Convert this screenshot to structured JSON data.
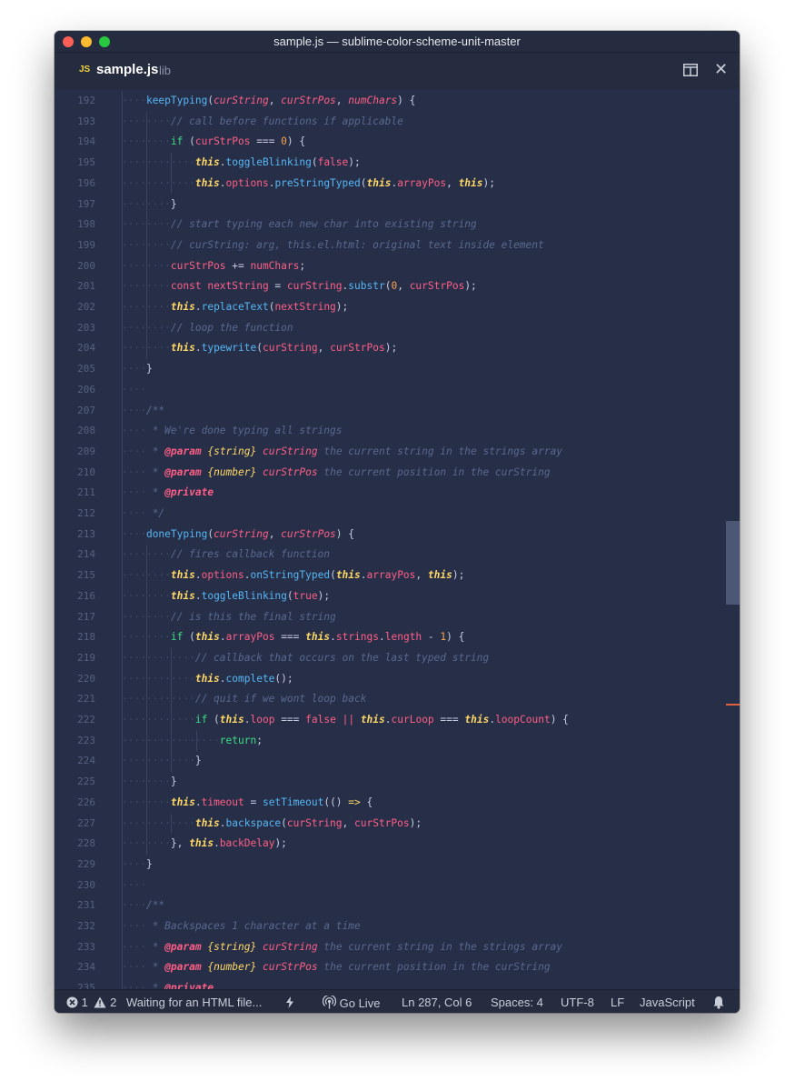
{
  "window": {
    "title": "sample.js — sublime-color-scheme-unit-master"
  },
  "tab": {
    "icon_text": "JS",
    "file": "sample.js",
    "dir": "lib"
  },
  "icons": {
    "split": "split-pane-icon",
    "close": "close-icon",
    "errors": "error-circle-icon",
    "warnings": "warning-triangle-icon",
    "plugin": "lightning-icon",
    "golive": "broadcast-icon",
    "notify": "bell-icon"
  },
  "editor": {
    "lines": [
      {
        "n": "192",
        "d": 1,
        "t": [
          [
            "f",
            "keepTyping"
          ],
          [
            "pl",
            "("
          ],
          [
            "p",
            "curString"
          ],
          [
            "pl",
            ", "
          ],
          [
            "p",
            "curStrPos"
          ],
          [
            "pl",
            ", "
          ],
          [
            "p",
            "numChars"
          ],
          [
            "pl",
            ") {"
          ]
        ]
      },
      {
        "n": "193",
        "d": 2,
        "t": [
          [
            "c",
            "// call before functions if applicable"
          ]
        ]
      },
      {
        "n": "194",
        "d": 2,
        "t": [
          [
            "k",
            "if"
          ],
          [
            "pl",
            " ("
          ],
          [
            "v",
            "curStrPos"
          ],
          [
            "pl",
            " === "
          ],
          [
            "n",
            "0"
          ],
          [
            "pl",
            ") {"
          ]
        ]
      },
      {
        "n": "195",
        "d": 3,
        "t": [
          [
            "th",
            "this"
          ],
          [
            "pl",
            "."
          ],
          [
            "f",
            "toggleBlinking"
          ],
          [
            "pl",
            "("
          ],
          [
            "v",
            "false"
          ],
          [
            "pl",
            ");"
          ]
        ]
      },
      {
        "n": "196",
        "d": 3,
        "t": [
          [
            "th",
            "this"
          ],
          [
            "pl",
            "."
          ],
          [
            "v",
            "options"
          ],
          [
            "pl",
            "."
          ],
          [
            "f",
            "preStringTyped"
          ],
          [
            "pl",
            "("
          ],
          [
            "th",
            "this"
          ],
          [
            "pl",
            "."
          ],
          [
            "v",
            "arrayPos"
          ],
          [
            "pl",
            ", "
          ],
          [
            "th",
            "this"
          ],
          [
            "pl",
            ");"
          ]
        ]
      },
      {
        "n": "197",
        "d": 2,
        "t": [
          [
            "pl",
            "}"
          ]
        ]
      },
      {
        "n": "198",
        "d": 2,
        "t": [
          [
            "c",
            "// start typing each new char into existing string"
          ]
        ]
      },
      {
        "n": "199",
        "d": 2,
        "t": [
          [
            "c",
            "// curString: arg, this.el.html: original text inside element"
          ]
        ]
      },
      {
        "n": "200",
        "d": 2,
        "t": [
          [
            "v",
            "curStrPos"
          ],
          [
            "pl",
            " += "
          ],
          [
            "v",
            "numChars"
          ],
          [
            "pl",
            ";"
          ]
        ]
      },
      {
        "n": "201",
        "d": 2,
        "t": [
          [
            "v",
            "const"
          ],
          [
            "pl",
            " "
          ],
          [
            "v",
            "nextString"
          ],
          [
            "pl",
            " = "
          ],
          [
            "v",
            "curString"
          ],
          [
            "pl",
            "."
          ],
          [
            "f",
            "substr"
          ],
          [
            "pl",
            "("
          ],
          [
            "n",
            "0"
          ],
          [
            "pl",
            ", "
          ],
          [
            "v",
            "curStrPos"
          ],
          [
            "pl",
            ");"
          ]
        ]
      },
      {
        "n": "202",
        "d": 2,
        "t": [
          [
            "th",
            "this"
          ],
          [
            "pl",
            "."
          ],
          [
            "f",
            "replaceText"
          ],
          [
            "pl",
            "("
          ],
          [
            "v",
            "nextString"
          ],
          [
            "pl",
            ");"
          ]
        ]
      },
      {
        "n": "203",
        "d": 2,
        "t": [
          [
            "c",
            "// loop the function"
          ]
        ]
      },
      {
        "n": "204",
        "d": 2,
        "t": [
          [
            "th",
            "this"
          ],
          [
            "pl",
            "."
          ],
          [
            "f",
            "typewrite"
          ],
          [
            "pl",
            "("
          ],
          [
            "v",
            "curString"
          ],
          [
            "pl",
            ", "
          ],
          [
            "v",
            "curStrPos"
          ],
          [
            "pl",
            ");"
          ]
        ]
      },
      {
        "n": "205",
        "d": 1,
        "t": [
          [
            "pl",
            "}"
          ]
        ]
      },
      {
        "n": "206",
        "d": 1,
        "t": []
      },
      {
        "n": "207",
        "d": 1,
        "t": [
          [
            "c",
            "/**"
          ]
        ]
      },
      {
        "n": "208",
        "d": 1,
        "t": [
          [
            "c",
            " * We're done typing all strings"
          ]
        ]
      },
      {
        "n": "209",
        "d": 1,
        "t": [
          [
            "c",
            " * "
          ],
          [
            "tg",
            "@param"
          ],
          [
            "pl",
            " "
          ],
          [
            "ty",
            "{string}"
          ],
          [
            "pl",
            " "
          ],
          [
            "p",
            "curString"
          ],
          [
            "c",
            " the current string in the strings array"
          ]
        ]
      },
      {
        "n": "210",
        "d": 1,
        "t": [
          [
            "c",
            " * "
          ],
          [
            "tg",
            "@param"
          ],
          [
            "pl",
            " "
          ],
          [
            "ty",
            "{number}"
          ],
          [
            "pl",
            " "
          ],
          [
            "p",
            "curStrPos"
          ],
          [
            "c",
            " the current position in the curString"
          ]
        ]
      },
      {
        "n": "211",
        "d": 1,
        "t": [
          [
            "c",
            " * "
          ],
          [
            "tg",
            "@private"
          ]
        ]
      },
      {
        "n": "212",
        "d": 1,
        "t": [
          [
            "c",
            " */"
          ]
        ]
      },
      {
        "n": "213",
        "d": 1,
        "t": [
          [
            "f",
            "doneTyping"
          ],
          [
            "pl",
            "("
          ],
          [
            "p",
            "curString"
          ],
          [
            "pl",
            ", "
          ],
          [
            "p",
            "curStrPos"
          ],
          [
            "pl",
            ") {"
          ]
        ]
      },
      {
        "n": "214",
        "d": 2,
        "t": [
          [
            "c",
            "// fires callback function"
          ]
        ]
      },
      {
        "n": "215",
        "d": 2,
        "t": [
          [
            "th",
            "this"
          ],
          [
            "pl",
            "."
          ],
          [
            "v",
            "options"
          ],
          [
            "pl",
            "."
          ],
          [
            "f",
            "onStringTyped"
          ],
          [
            "pl",
            "("
          ],
          [
            "th",
            "this"
          ],
          [
            "pl",
            "."
          ],
          [
            "v",
            "arrayPos"
          ],
          [
            "pl",
            ", "
          ],
          [
            "th",
            "this"
          ],
          [
            "pl",
            ");"
          ]
        ]
      },
      {
        "n": "216",
        "d": 2,
        "t": [
          [
            "th",
            "this"
          ],
          [
            "pl",
            "."
          ],
          [
            "f",
            "toggleBlinking"
          ],
          [
            "pl",
            "("
          ],
          [
            "v",
            "true"
          ],
          [
            "pl",
            ");"
          ]
        ]
      },
      {
        "n": "217",
        "d": 2,
        "t": [
          [
            "c",
            "// is this the final string"
          ]
        ]
      },
      {
        "n": "218",
        "d": 2,
        "t": [
          [
            "k",
            "if"
          ],
          [
            "pl",
            " ("
          ],
          [
            "th",
            "this"
          ],
          [
            "pl",
            "."
          ],
          [
            "v",
            "arrayPos"
          ],
          [
            "pl",
            " === "
          ],
          [
            "th",
            "this"
          ],
          [
            "pl",
            "."
          ],
          [
            "v",
            "strings"
          ],
          [
            "pl",
            "."
          ],
          [
            "v",
            "length"
          ],
          [
            "pl",
            " - "
          ],
          [
            "n",
            "1"
          ],
          [
            "pl",
            ") {"
          ]
        ]
      },
      {
        "n": "219",
        "d": 3,
        "t": [
          [
            "c",
            "// callback that occurs on the last typed string"
          ]
        ]
      },
      {
        "n": "220",
        "d": 3,
        "t": [
          [
            "th",
            "this"
          ],
          [
            "pl",
            "."
          ],
          [
            "f",
            "complete"
          ],
          [
            "pl",
            "();"
          ]
        ]
      },
      {
        "n": "221",
        "d": 3,
        "t": [
          [
            "c",
            "// quit if we wont loop back"
          ]
        ]
      },
      {
        "n": "222",
        "d": 3,
        "t": [
          [
            "k",
            "if"
          ],
          [
            "pl",
            " ("
          ],
          [
            "th",
            "this"
          ],
          [
            "pl",
            "."
          ],
          [
            "v",
            "loop"
          ],
          [
            "pl",
            " === "
          ],
          [
            "v",
            "false"
          ],
          [
            "pl",
            " "
          ],
          [
            "v",
            "||"
          ],
          [
            "pl",
            " "
          ],
          [
            "th",
            "this"
          ],
          [
            "pl",
            "."
          ],
          [
            "v",
            "curLoop"
          ],
          [
            "pl",
            " === "
          ],
          [
            "th",
            "this"
          ],
          [
            "pl",
            "."
          ],
          [
            "v",
            "loopCount"
          ],
          [
            "pl",
            ") {"
          ]
        ]
      },
      {
        "n": "223",
        "d": 4,
        "t": [
          [
            "k",
            "return"
          ],
          [
            "pl",
            ";"
          ]
        ]
      },
      {
        "n": "224",
        "d": 3,
        "t": [
          [
            "pl",
            "}"
          ]
        ]
      },
      {
        "n": "225",
        "d": 2,
        "t": [
          [
            "pl",
            "}"
          ]
        ]
      },
      {
        "n": "226",
        "d": 2,
        "t": [
          [
            "th",
            "this"
          ],
          [
            "pl",
            "."
          ],
          [
            "v",
            "timeout"
          ],
          [
            "pl",
            " = "
          ],
          [
            "f",
            "setTimeout"
          ],
          [
            "pl",
            "(() "
          ],
          [
            "ar",
            "=>"
          ],
          [
            "pl",
            " {"
          ]
        ]
      },
      {
        "n": "227",
        "d": 3,
        "t": [
          [
            "th",
            "this"
          ],
          [
            "pl",
            "."
          ],
          [
            "f",
            "backspace"
          ],
          [
            "pl",
            "("
          ],
          [
            "v",
            "curString"
          ],
          [
            "pl",
            ", "
          ],
          [
            "v",
            "curStrPos"
          ],
          [
            "pl",
            ");"
          ]
        ]
      },
      {
        "n": "228",
        "d": 2,
        "t": [
          [
            "pl",
            "}, "
          ],
          [
            "th",
            "this"
          ],
          [
            "pl",
            "."
          ],
          [
            "v",
            "backDelay"
          ],
          [
            "pl",
            ");"
          ]
        ]
      },
      {
        "n": "229",
        "d": 1,
        "t": [
          [
            "pl",
            "}"
          ]
        ]
      },
      {
        "n": "230",
        "d": 1,
        "t": []
      },
      {
        "n": "231",
        "d": 1,
        "t": [
          [
            "c",
            "/**"
          ]
        ]
      },
      {
        "n": "232",
        "d": 1,
        "t": [
          [
            "c",
            " * Backspaces 1 character at a time"
          ]
        ]
      },
      {
        "n": "233",
        "d": 1,
        "t": [
          [
            "c",
            " * "
          ],
          [
            "tg",
            "@param"
          ],
          [
            "pl",
            " "
          ],
          [
            "ty",
            "{string}"
          ],
          [
            "pl",
            " "
          ],
          [
            "p",
            "curString"
          ],
          [
            "c",
            " the current string in the strings array"
          ]
        ]
      },
      {
        "n": "234",
        "d": 1,
        "t": [
          [
            "c",
            " * "
          ],
          [
            "tg",
            "@param"
          ],
          [
            "pl",
            " "
          ],
          [
            "ty",
            "{number}"
          ],
          [
            "pl",
            " "
          ],
          [
            "p",
            "curStrPos"
          ],
          [
            "c",
            " the current position in the curString"
          ]
        ]
      },
      {
        "n": "235",
        "d": 1,
        "t": [
          [
            "c",
            " * "
          ],
          [
            "tg",
            "@private"
          ]
        ]
      }
    ]
  },
  "status": {
    "errors": "1",
    "warnings": "2",
    "message": "Waiting for an HTML file...",
    "golive": "Go Live",
    "position": "Ln 287, Col 6",
    "spaces": "Spaces: 4",
    "encoding": "UTF-8",
    "eol": "LF",
    "language": "JavaScript"
  }
}
